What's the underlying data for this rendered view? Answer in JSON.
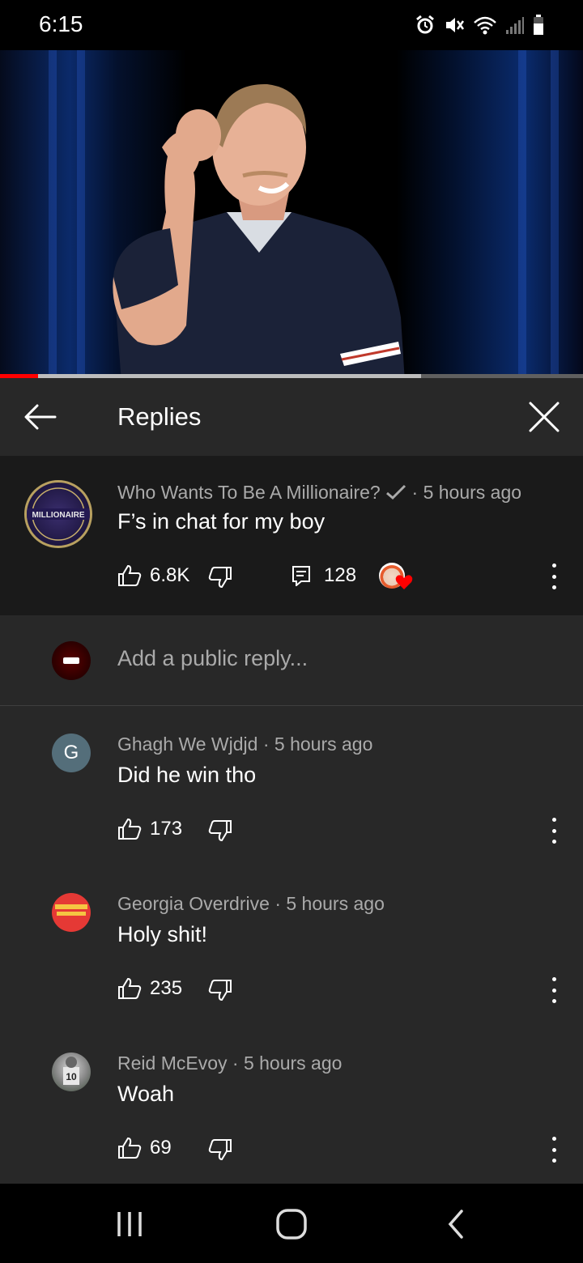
{
  "status": {
    "time": "6:15"
  },
  "video": {
    "progress_played": 0.065,
    "progress_buffered": 0.722
  },
  "header": {
    "title": "Replies"
  },
  "parent_comment": {
    "author": "Who Wants To Be A Millionaire?",
    "time": "5 hours ago",
    "text": "F’s in chat for my boy",
    "likes": "6.8K",
    "replies_count": "128",
    "avatar_text": "MILLIONAIRE"
  },
  "reply_input": {
    "placeholder": "Add a public reply..."
  },
  "replies": [
    {
      "author": "Ghagh We Wjdjd",
      "time": "5 hours ago",
      "text": "Did he win tho",
      "likes": "173",
      "avatar_letter": "G",
      "avatar_color": "#546e7a"
    },
    {
      "author": "Georgia Overdrive",
      "time": "5 hours ago",
      "text": "Holy shit!",
      "likes": "235",
      "avatar_color": "#e53935"
    },
    {
      "author": "Reid McEvoy",
      "time": "5 hours ago",
      "text": "Woah",
      "likes": "69",
      "avatar_color": "#9e9e9e"
    }
  ],
  "colors": {
    "panel": "#282828",
    "highlight": "#1a1a1a",
    "meta": "#aaaaaa",
    "accent": "#ff0000"
  }
}
